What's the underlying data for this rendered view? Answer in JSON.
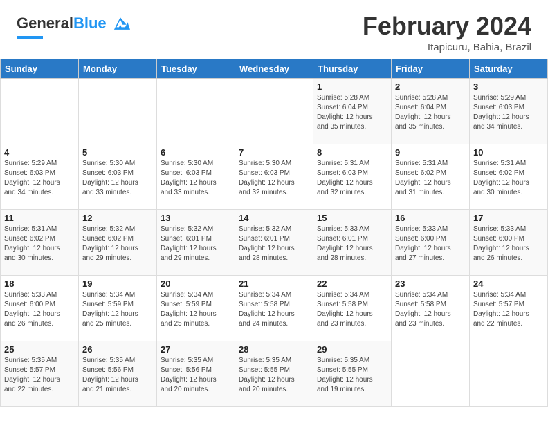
{
  "header": {
    "logo_general": "General",
    "logo_blue": "Blue",
    "month_title": "February 2024",
    "location": "Itapicuru, Bahia, Brazil"
  },
  "columns": [
    "Sunday",
    "Monday",
    "Tuesday",
    "Wednesday",
    "Thursday",
    "Friday",
    "Saturday"
  ],
  "weeks": [
    [
      {
        "day": "",
        "info": ""
      },
      {
        "day": "",
        "info": ""
      },
      {
        "day": "",
        "info": ""
      },
      {
        "day": "",
        "info": ""
      },
      {
        "day": "1",
        "info": "Sunrise: 5:28 AM\nSunset: 6:04 PM\nDaylight: 12 hours\nand 35 minutes."
      },
      {
        "day": "2",
        "info": "Sunrise: 5:28 AM\nSunset: 6:04 PM\nDaylight: 12 hours\nand 35 minutes."
      },
      {
        "day": "3",
        "info": "Sunrise: 5:29 AM\nSunset: 6:03 PM\nDaylight: 12 hours\nand 34 minutes."
      }
    ],
    [
      {
        "day": "4",
        "info": "Sunrise: 5:29 AM\nSunset: 6:03 PM\nDaylight: 12 hours\nand 34 minutes."
      },
      {
        "day": "5",
        "info": "Sunrise: 5:30 AM\nSunset: 6:03 PM\nDaylight: 12 hours\nand 33 minutes."
      },
      {
        "day": "6",
        "info": "Sunrise: 5:30 AM\nSunset: 6:03 PM\nDaylight: 12 hours\nand 33 minutes."
      },
      {
        "day": "7",
        "info": "Sunrise: 5:30 AM\nSunset: 6:03 PM\nDaylight: 12 hours\nand 32 minutes."
      },
      {
        "day": "8",
        "info": "Sunrise: 5:31 AM\nSunset: 6:03 PM\nDaylight: 12 hours\nand 32 minutes."
      },
      {
        "day": "9",
        "info": "Sunrise: 5:31 AM\nSunset: 6:02 PM\nDaylight: 12 hours\nand 31 minutes."
      },
      {
        "day": "10",
        "info": "Sunrise: 5:31 AM\nSunset: 6:02 PM\nDaylight: 12 hours\nand 30 minutes."
      }
    ],
    [
      {
        "day": "11",
        "info": "Sunrise: 5:31 AM\nSunset: 6:02 PM\nDaylight: 12 hours\nand 30 minutes."
      },
      {
        "day": "12",
        "info": "Sunrise: 5:32 AM\nSunset: 6:02 PM\nDaylight: 12 hours\nand 29 minutes."
      },
      {
        "day": "13",
        "info": "Sunrise: 5:32 AM\nSunset: 6:01 PM\nDaylight: 12 hours\nand 29 minutes."
      },
      {
        "day": "14",
        "info": "Sunrise: 5:32 AM\nSunset: 6:01 PM\nDaylight: 12 hours\nand 28 minutes."
      },
      {
        "day": "15",
        "info": "Sunrise: 5:33 AM\nSunset: 6:01 PM\nDaylight: 12 hours\nand 28 minutes."
      },
      {
        "day": "16",
        "info": "Sunrise: 5:33 AM\nSunset: 6:00 PM\nDaylight: 12 hours\nand 27 minutes."
      },
      {
        "day": "17",
        "info": "Sunrise: 5:33 AM\nSunset: 6:00 PM\nDaylight: 12 hours\nand 26 minutes."
      }
    ],
    [
      {
        "day": "18",
        "info": "Sunrise: 5:33 AM\nSunset: 6:00 PM\nDaylight: 12 hours\nand 26 minutes."
      },
      {
        "day": "19",
        "info": "Sunrise: 5:34 AM\nSunset: 5:59 PM\nDaylight: 12 hours\nand 25 minutes."
      },
      {
        "day": "20",
        "info": "Sunrise: 5:34 AM\nSunset: 5:59 PM\nDaylight: 12 hours\nand 25 minutes."
      },
      {
        "day": "21",
        "info": "Sunrise: 5:34 AM\nSunset: 5:58 PM\nDaylight: 12 hours\nand 24 minutes."
      },
      {
        "day": "22",
        "info": "Sunrise: 5:34 AM\nSunset: 5:58 PM\nDaylight: 12 hours\nand 23 minutes."
      },
      {
        "day": "23",
        "info": "Sunrise: 5:34 AM\nSunset: 5:58 PM\nDaylight: 12 hours\nand 23 minutes."
      },
      {
        "day": "24",
        "info": "Sunrise: 5:34 AM\nSunset: 5:57 PM\nDaylight: 12 hours\nand 22 minutes."
      }
    ],
    [
      {
        "day": "25",
        "info": "Sunrise: 5:35 AM\nSunset: 5:57 PM\nDaylight: 12 hours\nand 22 minutes."
      },
      {
        "day": "26",
        "info": "Sunrise: 5:35 AM\nSunset: 5:56 PM\nDaylight: 12 hours\nand 21 minutes."
      },
      {
        "day": "27",
        "info": "Sunrise: 5:35 AM\nSunset: 5:56 PM\nDaylight: 12 hours\nand 20 minutes."
      },
      {
        "day": "28",
        "info": "Sunrise: 5:35 AM\nSunset: 5:55 PM\nDaylight: 12 hours\nand 20 minutes."
      },
      {
        "day": "29",
        "info": "Sunrise: 5:35 AM\nSunset: 5:55 PM\nDaylight: 12 hours\nand 19 minutes."
      },
      {
        "day": "",
        "info": ""
      },
      {
        "day": "",
        "info": ""
      }
    ]
  ]
}
